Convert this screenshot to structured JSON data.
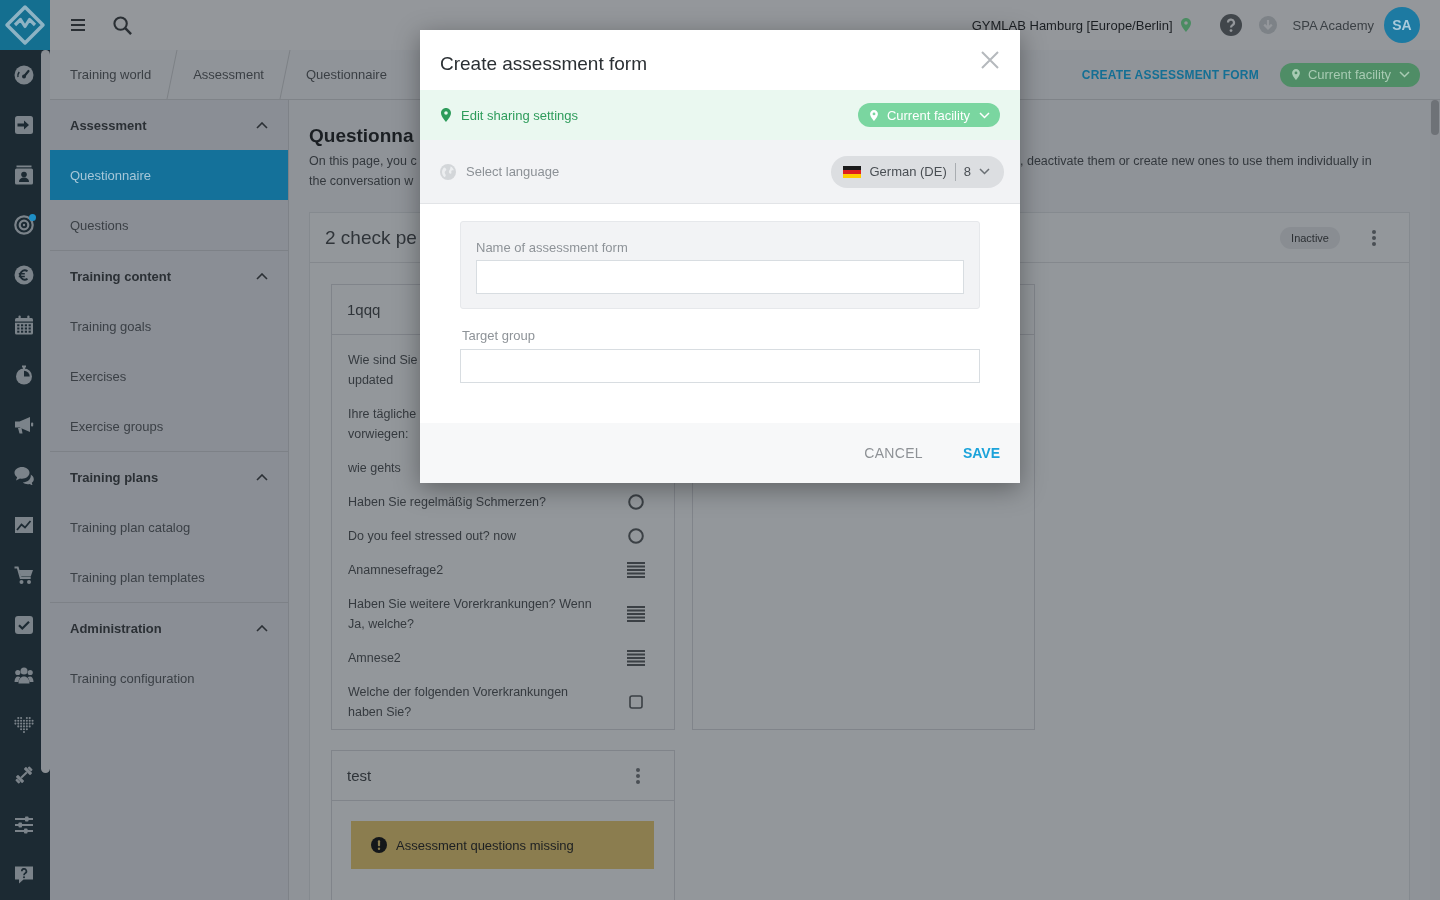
{
  "rail": {
    "items": [
      {
        "notification": false
      },
      {
        "notification": false
      },
      {
        "notification": false
      },
      {
        "notification": true
      },
      {
        "notification": false
      },
      {
        "notification": false
      },
      {
        "notification": false
      },
      {
        "notification": false
      },
      {
        "notification": false
      },
      {
        "notification": false
      },
      {
        "notification": false
      },
      {
        "notification": false
      },
      {
        "notification": false
      },
      {
        "notification": false
      },
      {
        "notification": false
      },
      {
        "notification": false
      },
      {
        "notification": false
      }
    ]
  },
  "topbar": {
    "facility": "GYMLAB Hamburg [Europe/Berlin]",
    "user": "SPA Academy",
    "avatar": "SA"
  },
  "breadcrumbs": [
    {
      "label": "Training world"
    },
    {
      "label": "Assessment"
    },
    {
      "label": "Questionnaire"
    }
  ],
  "page_actions": {
    "create_button": "CREATE ASSESSMENT FORM",
    "scope_button": "Current facility"
  },
  "sidebar": {
    "sections": [
      {
        "label": "Assessment",
        "expanded": true,
        "items": [
          {
            "label": "Questionnaire",
            "selected": true
          },
          {
            "label": "Questions",
            "selected": false
          }
        ]
      },
      {
        "label": "Training content",
        "expanded": true,
        "items": [
          {
            "label": "Training goals",
            "selected": false
          },
          {
            "label": "Exercises",
            "selected": false
          },
          {
            "label": "Exercise groups",
            "selected": false
          }
        ]
      },
      {
        "label": "Training plans",
        "expanded": true,
        "items": [
          {
            "label": "Training plan catalog",
            "selected": false
          },
          {
            "label": "Training plan templates",
            "selected": false
          }
        ]
      },
      {
        "label": "Administration",
        "expanded": true,
        "items": [
          {
            "label": "Training configuration",
            "selected": false
          }
        ]
      }
    ]
  },
  "page": {
    "title": "Questionna",
    "intro_left": [
      "On this page, you c",
      "the conversation w"
    ],
    "intro_right": ", deactivate them or create new ones to use them individually in"
  },
  "questionnaire": {
    "title": "2 check pe",
    "status": "Inactive",
    "forms": [
      {
        "title": "1qqq",
        "questions": [
          {
            "lines": [
              "Wie sind Sie",
              "updated"
            ]
          },
          {
            "lines": [
              "Ihre tägliche",
              "vorwiegen:"
            ]
          },
          {
            "lines": [
              "wie gehts"
            ]
          },
          {
            "lines": [
              "Haben Sie regelmäßig Schmerzen?"
            ],
            "kind": "radio"
          },
          {
            "lines": [
              "Do you feel stressed out? now"
            ],
            "kind": "radio"
          },
          {
            "lines": [
              "Anamnesefrage2"
            ],
            "kind": "text"
          },
          {
            "lines": [
              "Haben Sie weitere Vorerkrankungen? Wenn",
              "Ja, welche?"
            ],
            "kind": "text"
          },
          {
            "lines": [
              "Amnese2"
            ],
            "kind": "text"
          },
          {
            "lines": [
              "Welche der folgenden Vorerkrankungen",
              "haben Sie?"
            ],
            "kind": "checkbox"
          }
        ]
      },
      {
        "title": "test",
        "warning": "Assessment questions missing"
      }
    ]
  },
  "dialog": {
    "title": "Create assessment form",
    "sharing": {
      "label": "Edit sharing settings",
      "scope": "Current facility"
    },
    "language": {
      "label": "Select language",
      "value": "German (DE)",
      "count": "8"
    },
    "fields": [
      {
        "label": "Name of assessment form",
        "kind": "grouped"
      },
      {
        "label": "Target group",
        "kind": "plain"
      }
    ],
    "buttons": [
      {
        "label": "CANCEL",
        "kind": "secondary"
      },
      {
        "label": "SAVE",
        "kind": "primary"
      }
    ]
  }
}
